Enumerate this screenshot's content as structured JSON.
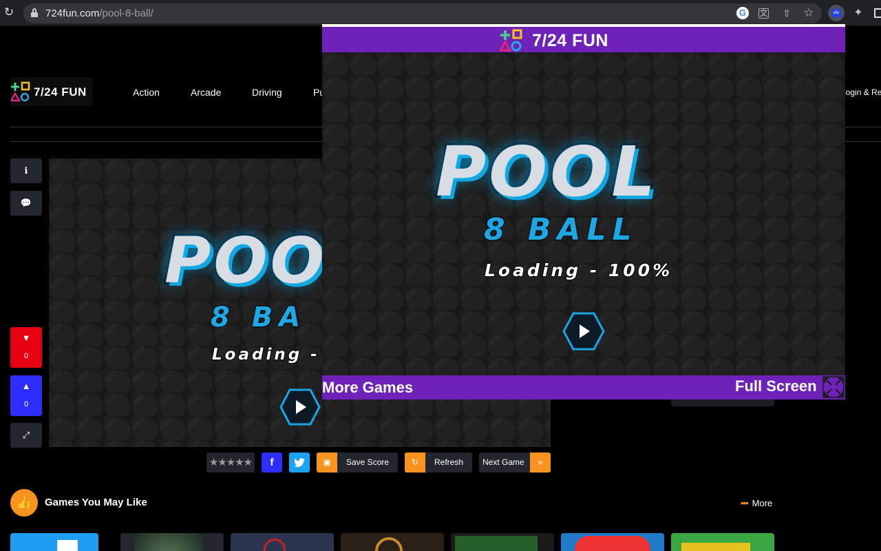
{
  "browser": {
    "url_host": "724fun.com",
    "url_path": "/pool-8-ball/",
    "google_icon": "G",
    "translate_icon": "translate-icon",
    "extension_label": "ofu"
  },
  "site": {
    "logo_text": "7/24 FUN",
    "nav": [
      "Action",
      "Arcade",
      "Driving",
      "Pu"
    ],
    "login": "Login & Reg"
  },
  "sidebar": {
    "info_icon": "info-icon",
    "comment_icon": "comment-icon",
    "dislike_count": "0",
    "like_count": "0",
    "expand_icon": "expand-icon"
  },
  "game": {
    "title_line1": "POOL",
    "title_line2": "8 BALL",
    "loading_text": "Loading - 100%",
    "main_loading_text": "Loading -",
    "main_title_line1": "POO",
    "main_title_line2": "8 BA"
  },
  "actions": {
    "stars": "★★★★★",
    "facebook": "f",
    "twitter_icon": "twitter-icon",
    "save_score": "Save Score",
    "refresh": "Refresh",
    "next_game": "Next Game"
  },
  "section": {
    "title": "Games You May Like",
    "more": "More"
  },
  "popup": {
    "logo_text": "7/24 FUN",
    "more_games": "More Games",
    "full_screen": "Full Screen"
  },
  "colors": {
    "purple": "#6f22b7",
    "orange": "#f7931e",
    "red": "#e60012",
    "blue": "#2d2dff",
    "cyan": "#20a6e0"
  }
}
